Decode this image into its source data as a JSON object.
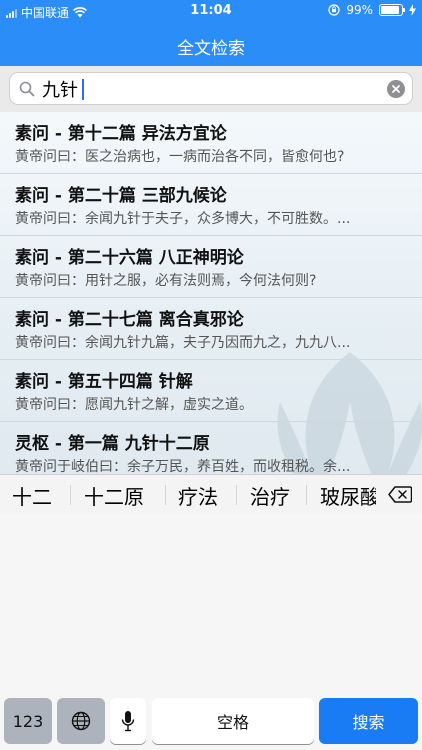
{
  "status_bar": {
    "carrier": "中国联通",
    "time": "11:04",
    "battery": "99%",
    "battery_level": 0.99
  },
  "nav": {
    "title": "全文检索"
  },
  "search": {
    "query": "九针"
  },
  "results": [
    {
      "title": "素问 - 第十二篇 异法方宜论",
      "snippet": "黄帝问曰：医之治病也，一病而治各不同，皆愈何也?"
    },
    {
      "title": "素问 - 第二十篇 三部九候论",
      "snippet": "黄帝问曰：余闻九针于夫子，众多博大，不可胜数。..."
    },
    {
      "title": "素问 - 第二十六篇 八正神明论",
      "snippet": "黄帝问曰：用针之服，必有法则焉，今何法何则?"
    },
    {
      "title": "素问 - 第二十七篇 离合真邪论",
      "snippet": "黄帝问曰：余闻九针九篇，夫子乃因而九之，九九八..."
    },
    {
      "title": "素问 - 第五十四篇 针解",
      "snippet": "黄帝问曰：愿闻九针之解，虚实之道。"
    },
    {
      "title": "灵枢 - 第一篇 九针十二原",
      "snippet": "黄帝问于岐伯曰：余子万民，养百姓，而收租税。余..."
    }
  ],
  "candidates": [
    "十二",
    "十二原",
    "疗法",
    "治疗",
    "玻尿酸"
  ],
  "keyboard": {
    "num_label": "123",
    "globe_icon": "globe-icon",
    "mic_icon": "microphone-icon",
    "space_label": "空格",
    "search_label": "搜索"
  },
  "colors": {
    "accent": "#2b8ef8",
    "search_key": "#1a7cf5"
  }
}
